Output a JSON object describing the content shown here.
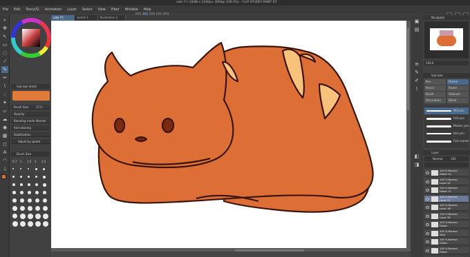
{
  "window": {
    "title": "cats (*) (2048 x 2160px 300dpi 100.0%) - CLIP STUDIO PAINT EX"
  },
  "menu": {
    "items": [
      "File",
      "Edit",
      "Story(S)",
      "Animation",
      "Layer",
      "Select",
      "View",
      "Filter",
      "Window",
      "Help"
    ]
  },
  "tabs": [
    {
      "label": "cats (*)",
      "active": true
    },
    {
      "label": "sketch 1",
      "active": false
    },
    {
      "label": "Illustration 2",
      "active": false
    }
  ],
  "left_panel": {
    "tool_property_title": "Sub tool detail",
    "brush_size_label": "Brush Size",
    "brush_size_value": "17.0",
    "opacity_label": "Opacity",
    "blending_mode_label": "Blending mode",
    "blending_mode_value": "Normal",
    "antialiasing_label": "Anti-aliasing",
    "stabilization_label": "Stabilization",
    "adjust_by_speed_label": "Adjust by speed",
    "brush_size_panel_title": "Brush Size",
    "brush_sizes": [
      "0.7",
      "1",
      "1.5",
      "2",
      "2.5"
    ]
  },
  "right_panel": {
    "navigator_title": "Navigator",
    "zoom_value": "100.0",
    "subtool_title": "Sub tool",
    "subtools": [
      "Pen",
      "Marker",
      "Pencil",
      "Pastel",
      "Brush",
      "Airbrush",
      "Decoration",
      "Blend"
    ],
    "brush_list": [
      "Mill pen",
      "Felt pen",
      "Marker pen",
      "Dot pen",
      "Flat marker"
    ],
    "layer_title": "Layer",
    "blend_mode": "Normal",
    "opacity": "100",
    "layers": [
      {
        "pct": "100 %",
        "mode": "Normal",
        "name": "Folder 10",
        "selected": false
      },
      {
        "pct": "100 %",
        "mode": "Normal",
        "name": "Layer 32",
        "selected": false
      },
      {
        "pct": "100 %",
        "mode": "Normal",
        "name": "Folder 11",
        "selected": false
      },
      {
        "pct": "100 %",
        "mode": "Normal",
        "name": "Layer 37",
        "selected": true
      },
      {
        "pct": "100 %",
        "mode": "Normal",
        "name": "Layer 36",
        "selected": false
      },
      {
        "pct": "100 %",
        "mode": "Normal",
        "name": "Layer 35",
        "selected": false
      },
      {
        "pct": "100 %",
        "mode": "Normal",
        "name": "Folder",
        "selected": false
      },
      {
        "pct": "100 %",
        "mode": "Normal",
        "name": "lines",
        "selected": false
      },
      {
        "pct": "100 %",
        "mode": "Normal",
        "name": "Folder",
        "selected": false
      },
      {
        "pct": "100 %",
        "mode": "Normal",
        "name": "Folder",
        "selected": false
      }
    ]
  },
  "colors": {
    "cat_body": "#dc6e36",
    "cat_outline": "#3a1508",
    "stripe": "#f8c27a",
    "eyes": "#7a2a10",
    "selected_layer": "#6a7a99"
  }
}
